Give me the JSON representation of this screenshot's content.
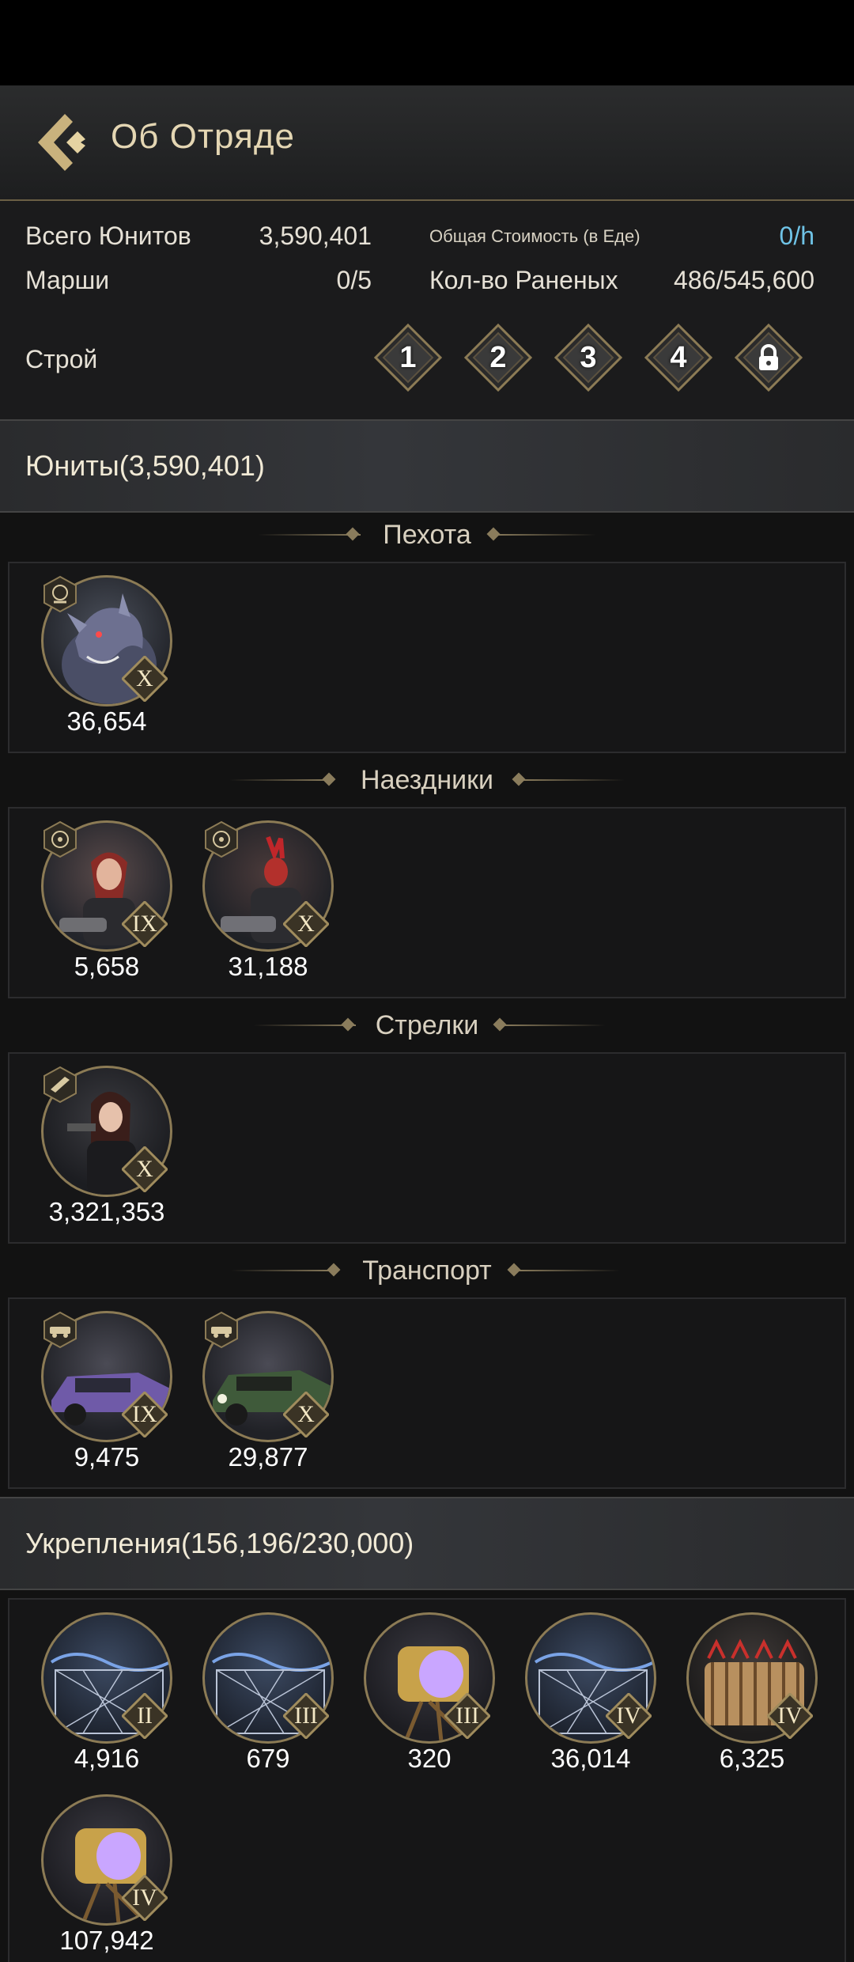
{
  "header": {
    "title": "Об Отряде"
  },
  "summary": {
    "total_units_label": "Всего Юнитов",
    "total_units_value": "3,590,401",
    "total_cost_label": "Общая Стоимость (в Еде)",
    "total_cost_value": "0/h",
    "marches_label": "Марши",
    "marches_value": "0/5",
    "wounded_label": "Кол-во Раненых",
    "wounded_value": "486/545,600",
    "formation_label": "Строй",
    "formations": [
      "1",
      "2",
      "3",
      "4"
    ]
  },
  "units_section": {
    "title": "Юниты(3,590,401)"
  },
  "categories": [
    {
      "label": "Пехота",
      "units": [
        {
          "tier": "X",
          "count": "36,654",
          "icon": "werewolf-portrait-icon"
        }
      ]
    },
    {
      "label": "Наездники",
      "units": [
        {
          "tier": "IX",
          "count": "5,658",
          "icon": "rider-woman-portrait-icon"
        },
        {
          "tier": "X",
          "count": "31,188",
          "icon": "rider-demon-portrait-icon"
        }
      ]
    },
    {
      "label": "Стрелки",
      "units": [
        {
          "tier": "X",
          "count": "3,321,353",
          "icon": "shooter-woman-portrait-icon"
        }
      ]
    },
    {
      "label": "Транспорт",
      "units": [
        {
          "tier": "IX",
          "count": "9,475",
          "icon": "purple-car-portrait-icon"
        },
        {
          "tier": "X",
          "count": "29,877",
          "icon": "green-car-portrait-icon"
        }
      ]
    }
  ],
  "fortifications_section": {
    "title": "Укрепления(156,196/230,000)"
  },
  "fortifications": [
    {
      "tier": "II",
      "count": "4,916",
      "icon": "barbed-fence-icon"
    },
    {
      "tier": "III",
      "count": "679",
      "icon": "barbed-fence-icon"
    },
    {
      "tier": "III",
      "count": "320",
      "icon": "searchlight-icon"
    },
    {
      "tier": "IV",
      "count": "36,014",
      "icon": "barbed-fence-icon"
    },
    {
      "tier": "IV",
      "count": "6,325",
      "icon": "spike-barricade-icon"
    },
    {
      "tier": "IV",
      "count": "107,942",
      "icon": "searchlight-icon"
    }
  ],
  "colors": {
    "gold": "#8c7b55",
    "cyan": "#6fc3e6",
    "background": "#121212"
  }
}
